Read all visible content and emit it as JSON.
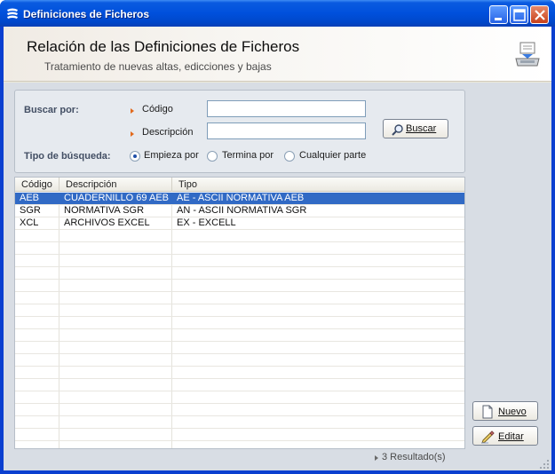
{
  "window": {
    "title": "Definiciones de Ficheros"
  },
  "header": {
    "title": "Relación de las Definiciones de Ficheros",
    "subtitle": "Tratamiento de nuevas altas, edicciones y bajas",
    "icon": "download-tray-icon"
  },
  "search": {
    "buscar_por_label": "Buscar por:",
    "codigo_label": "Código",
    "codigo_value": "",
    "descripcion_label": "Descripción",
    "descripcion_value": "",
    "buscar_button": "Buscar",
    "tipo_label": "Tipo de búsqueda:",
    "options": [
      {
        "label": "Empieza por",
        "selected": true
      },
      {
        "label": "Termina por",
        "selected": false
      },
      {
        "label": "Cualquier parte",
        "selected": false
      }
    ]
  },
  "grid": {
    "columns": [
      "Código",
      "Descripción",
      "Tipo"
    ],
    "rows": [
      {
        "codigo": "AEB",
        "descripcion": "CUADERNILLO 69 AEB",
        "tipo": "AE - ASCII NORMATIVA AEB",
        "selected": true
      },
      {
        "codigo": "SGR",
        "descripcion": "NORMATIVA SGR",
        "tipo": "AN - ASCII NORMATIVA SGR",
        "selected": false
      },
      {
        "codigo": "XCL",
        "descripcion": "ARCHIVOS EXCEL",
        "tipo": "EX - EXCELL",
        "selected": false
      }
    ]
  },
  "actions": {
    "nuevo": "Nuevo",
    "editar": "Editar"
  },
  "status": {
    "results": "3 Resultado(s)"
  },
  "colors": {
    "titlebar": "#0050dc",
    "selection": "#316ac5",
    "arrow": "#e2691c"
  }
}
